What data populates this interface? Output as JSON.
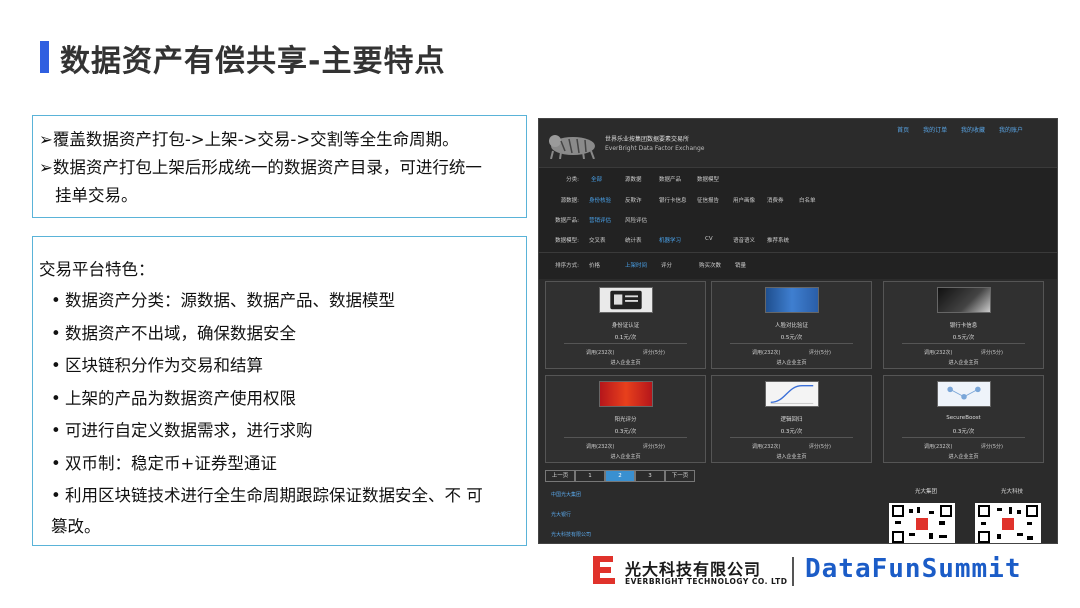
{
  "title": "数据资产有偿共享-主要特点",
  "box1": {
    "line1": "➢覆盖数据资产打包->上架->交易->交割等全生命周期。",
    "line2": "➢数据资产打包上架后形成统一的数据资产目录，可进行统一",
    "line3": "挂单交易。"
  },
  "box2": {
    "heading": "交易平台特色：",
    "bullets": [
      "数据资产分类：源数据、数据产品、数据模型",
      "数据资产不出域，确保数据安全",
      "区块链积分作为交易和结算",
      "上架的产品为数据资产使用权限",
      "可进行自定义数据需求，进行求购",
      "双币制：稳定币+证券型通证",
      "利用区块链技术进行全生命周期跟踪保证数据安全、不 可"
    ],
    "bullet_cont": "篡改。"
  },
  "screenshot": {
    "org_cn": "世界乐业按集团数据要素交易所",
    "org_en": "EverBright Data Factor Exchange",
    "top_links": [
      "首页",
      "我的订单",
      "我的收藏",
      "我的账户"
    ],
    "filters": {
      "cat_label": "分类:",
      "cat_opts": [
        "全部",
        "源数据",
        "数据产品",
        "数据模型"
      ],
      "src_label": "源数据:",
      "src_opts": [
        "身份核验",
        "反欺诈",
        "银行卡信息",
        "征信报告",
        "用户画像",
        "消费券",
        "白名单"
      ],
      "prod_label": "数据产品:",
      "prod_opts": [
        "营销评估",
        "风险评估"
      ],
      "model_label": "数据模型:",
      "model_opts": [
        "交叉表",
        "统计表",
        "机器学习",
        "CV",
        "语音语义",
        "推荐系统"
      ],
      "sort_label": "排序方式:",
      "sort_opts": [
        "价格",
        "上架时间",
        "评分",
        "购买次数",
        "销量"
      ]
    },
    "cards": [
      {
        "name": "身份证认证",
        "price": "0.1元/次",
        "calls": "调用(232次)",
        "rating": "评分(5分)",
        "go": "进入企业主页"
      },
      {
        "name": "人脸对比验证",
        "price": "0.5元/次",
        "calls": "调用(232次)",
        "rating": "评分(5分)",
        "go": "进入企业主页"
      },
      {
        "name": "银行卡信息",
        "price": "0.5元/次",
        "calls": "调用(232次)",
        "rating": "评分(5分)",
        "go": "进入企业主页"
      },
      {
        "name": "阳光评分",
        "price": "0.3元/次",
        "calls": "调用(232次)",
        "rating": "评分(5分)",
        "go": "进入企业主页"
      },
      {
        "name": "逻辑回归",
        "price": "0.3元/次",
        "calls": "调用(232次)",
        "rating": "评分(5分)",
        "go": "进入企业主页"
      },
      {
        "name": "SecureBoost",
        "price": "0.3元/次",
        "calls": "调用(232次)",
        "rating": "评分(5分)",
        "go": "进入企业主页"
      }
    ],
    "pager": [
      "上一页",
      "1",
      "2",
      "3",
      "下一页"
    ],
    "footer_links": [
      "中国光大集团",
      "光大银行",
      "光大科技有限公司"
    ],
    "qr_titles": [
      "光大集团",
      "光大科技"
    ]
  },
  "logo": {
    "cn": "光大科技有限公司",
    "en": "EVERBRIGHT TECHNOLOGY CO. LTD",
    "brand": "DataFunSummit"
  },
  "colors": {
    "accent": "#2f5fe0",
    "box_border": "#5ab3d8",
    "brand_blue": "#1b5cc7",
    "logo_red": "#e0322b"
  }
}
